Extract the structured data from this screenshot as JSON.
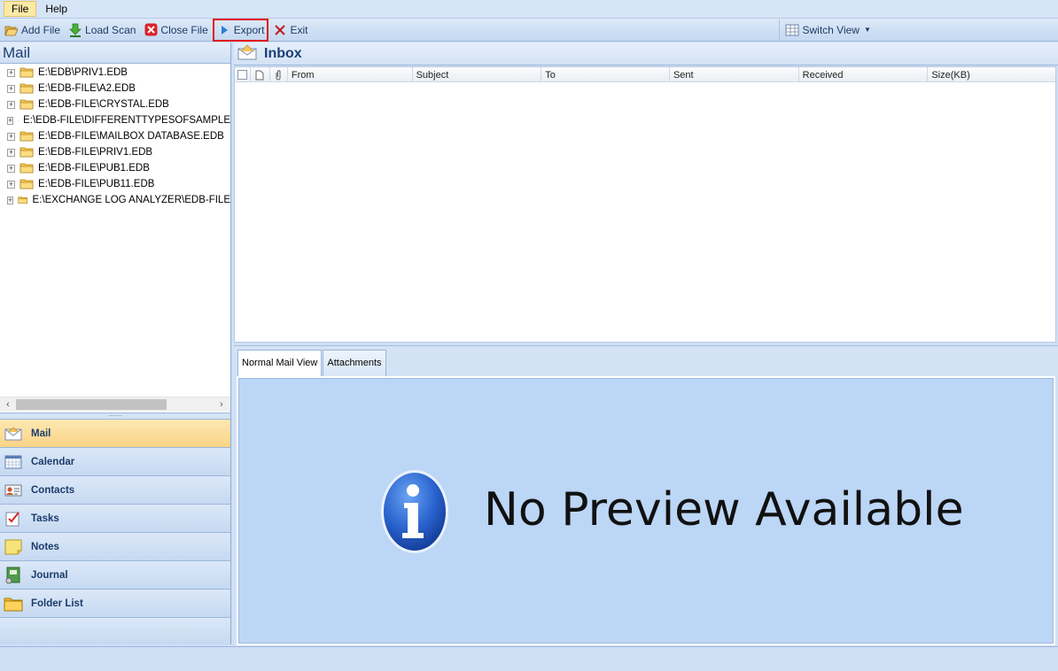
{
  "menu": {
    "file": "File",
    "help": "Help"
  },
  "toolbar": {
    "add_file": "Add File",
    "load_scan": "Load Scan",
    "close_file": "Close File",
    "export": "Export",
    "exit": "Exit",
    "switch_view": "Switch View"
  },
  "left": {
    "title": "Mail",
    "tree": [
      "E:\\EDB\\PRIV1.EDB",
      "E:\\EDB-FILE\\A2.EDB",
      "E:\\EDB-FILE\\CRYSTAL.EDB",
      "E:\\EDB-FILE\\DIFFERENTTYPESOFSAMPLE",
      "E:\\EDB-FILE\\MAILBOX DATABASE.EDB",
      "E:\\EDB-FILE\\PRIV1.EDB",
      "E:\\EDB-FILE\\PUB1.EDB",
      "E:\\EDB-FILE\\PUB11.EDB",
      "E:\\EXCHANGE LOG ANALYZER\\EDB-FILE"
    ],
    "nav": [
      "Mail",
      "Calendar",
      "Contacts",
      "Tasks",
      "Notes",
      "Journal",
      "Folder List"
    ]
  },
  "inbox": {
    "title": "Inbox",
    "columns": [
      "From",
      "Subject",
      "To",
      "Sent",
      "Received",
      "Size(KB)"
    ]
  },
  "preview": {
    "tabs": [
      "Normal Mail View",
      "Attachments"
    ],
    "message": "No Preview Available"
  }
}
